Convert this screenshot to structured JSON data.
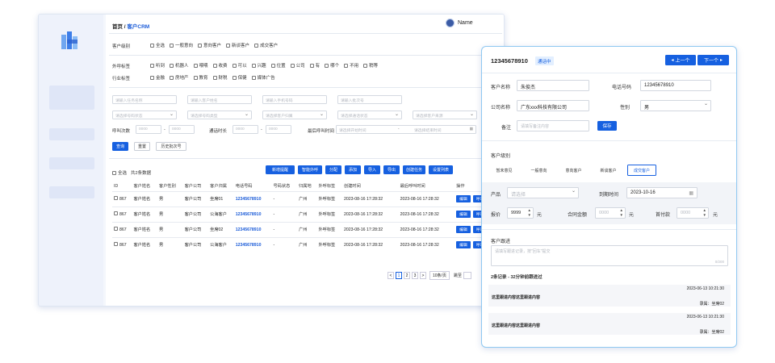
{
  "crumb": {
    "home": "首页",
    "sep": " / ",
    "current": "客户CRM"
  },
  "user": {
    "name": "Name"
  },
  "filter": {
    "level_label": "客户级别",
    "level_opts": [
      "全选",
      "一般意向",
      "意向客户",
      "新谈客户",
      "成交客户"
    ],
    "tags_label": "外呼标签",
    "tags_opts": [
      "听到",
      "机器人",
      "喂喂",
      "收费",
      "可以",
      "兴趣",
      "位置",
      "公司",
      "有",
      "哪个",
      "不用",
      "稍等"
    ],
    "industry_label": "行业标签",
    "industry_opts": [
      "金融",
      "房地产",
      "教育",
      "财税",
      "保健",
      "媒体广告"
    ],
    "row1": [
      "请输入任务名称",
      "请输入客户姓名",
      "请输入手机号码",
      "请输入批次号"
    ],
    "row2": [
      "请选择号码状态",
      "请选择号码类型",
      "请选择客户归属",
      "请选择通话状态",
      "请选择客户来源"
    ],
    "calls_label": "呼叫次数",
    "dur_label": "通话时长",
    "last_label": "最后呼叫时间",
    "num_ph": "0000",
    "start_ph": "请选择开始时间",
    "end_ph": "请选择结束时间",
    "dash": "-",
    "search": "查询",
    "reset": "重置",
    "history": "历史批次号"
  },
  "bar": {
    "select_all": "全选",
    "total": "共2条数据",
    "actions": [
      "新增提醒",
      "智能外呼",
      "分配",
      "添加",
      "导入",
      "导出",
      "创建任务",
      "设置列表"
    ]
  },
  "table": {
    "headers": [
      "ID",
      "客户姓名",
      "客户性别",
      "客户公司",
      "客户归属",
      "电话号码",
      "号码状态",
      "归属地",
      "外呼标签",
      "创建时间",
      "最后呼叫时间",
      "操作"
    ],
    "rows": [
      [
        "867",
        "客户姓名",
        "男",
        "客户公司",
        "坐席01",
        "12345678910",
        "-",
        "广州",
        "外呼标签",
        "2023-08-16 17:28:32",
        "2023-08-16 17:28:32"
      ],
      [
        "867",
        "客户姓名",
        "男",
        "客户公司",
        "公海客户",
        "12345678910",
        "-",
        "广州",
        "外呼标签",
        "2023-08-16 17:28:32",
        "2023-08-16 17:28:32"
      ],
      [
        "867",
        "客户姓名",
        "男",
        "客户公司",
        "坐席02",
        "12345678910",
        "-",
        "广州",
        "外呼标签",
        "2023-08-16 17:28:32",
        "2023-08-16 17:28:32"
      ],
      [
        "867",
        "客户姓名",
        "男",
        "客户公司",
        "公海客户",
        "12345678910",
        "-",
        "广州",
        "外呼标签",
        "2023-08-16 17:28:32",
        "2023-08-16 17:28:32"
      ]
    ],
    "edit": "编辑",
    "call": "呼叫"
  },
  "pager": {
    "prev": "<",
    "pages": [
      "1",
      "2",
      "3"
    ],
    "next": ">",
    "size": "10条/页",
    "jump": "跳至"
  },
  "panel": {
    "phone": "12345678910",
    "status": "通话中",
    "prev": "上一个",
    "next": "下一个",
    "name_label": "客户名称",
    "name_val": "朱俊杰",
    "tel_label": "电话号码",
    "tel_val": "12345678910",
    "company_label": "公司名称",
    "company_val": "广东xxx科技有限公司",
    "gender_label": "性别",
    "gender_val": "男",
    "note_label": "备注",
    "note_ph": "请填写备注内容",
    "save": "保存",
    "level_label": "客户级别",
    "levels": [
      "暂未意见",
      "一般意向",
      "意向客户",
      "新谈客户",
      "成交客户"
    ],
    "product_label": "产品",
    "product_ph": "请选择",
    "expire_label": "到期时间",
    "expire_val": "2023-10-16",
    "price_label": "报价",
    "price_val": "9999",
    "yuan": "元",
    "contract_label": "合同金额",
    "zero": "0000",
    "paid_label": "首付款",
    "follow_label": "客户跟进",
    "follow_ph": "请填写跟进记录，按\"回车\"提交",
    "follow_count": "0/200",
    "summary": "2条记录 - 32分钟前跟进过",
    "records": [
      {
        "time": "2023-06-13 10:21:30",
        "text": "这里跟进内容这里跟进内容",
        "who": "录属：坐席02"
      },
      {
        "time": "2023-06-13 10:21:30",
        "text": "这里跟进内容这里跟进内容",
        "who": "录属：坐席02"
      }
    ]
  },
  "colors": {
    "primary": "#1660e0",
    "panel_border": "#8fc8f1"
  }
}
